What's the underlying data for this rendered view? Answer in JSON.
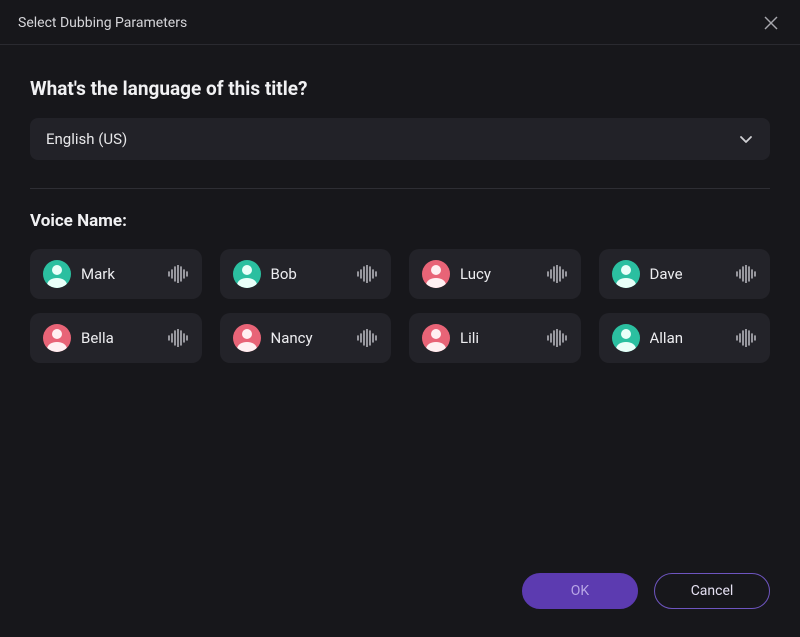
{
  "dialog": {
    "title": "Select Dubbing Parameters",
    "question": "What's the language of this title?",
    "language_selected": "English (US)",
    "voice_section_label": "Voice Name:"
  },
  "voices": [
    {
      "name": "Mark",
      "avatar_color": "teal"
    },
    {
      "name": "Bob",
      "avatar_color": "teal"
    },
    {
      "name": "Lucy",
      "avatar_color": "pink"
    },
    {
      "name": "Dave",
      "avatar_color": "teal"
    },
    {
      "name": "Bella",
      "avatar_color": "pink"
    },
    {
      "name": "Nancy",
      "avatar_color": "pink"
    },
    {
      "name": "Lili",
      "avatar_color": "pink"
    },
    {
      "name": "Allan",
      "avatar_color": "teal"
    }
  ],
  "buttons": {
    "ok": "OK",
    "cancel": "Cancel"
  }
}
